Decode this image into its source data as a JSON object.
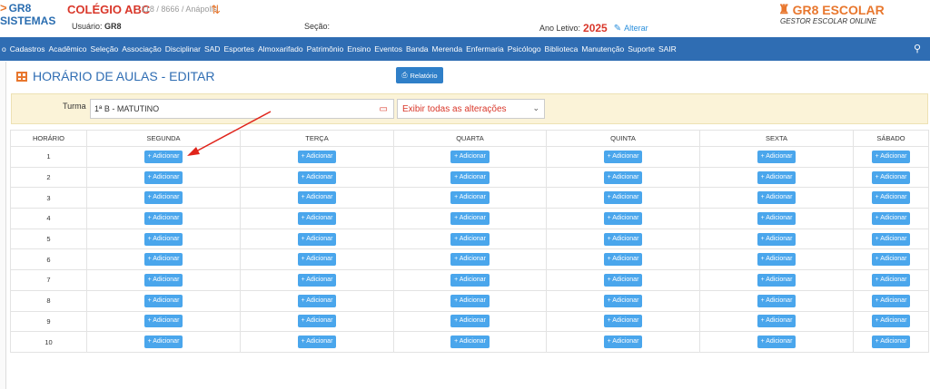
{
  "header": {
    "logo_line1": "GR8",
    "logo_line2": "SISTEMAS",
    "school_name": "COLÉGIO ABC",
    "school_info": "- 118 / 8666 / Anápolis",
    "usuario_label": "Usuário:",
    "usuario_value": "GR8",
    "secao_label": "Seção:",
    "ano_label": "Ano Letivo:",
    "ano_value": "2025",
    "alterar_label": "Alterar",
    "brand_title": "GR8 ESCOLAR",
    "brand_subtitle": "GESTOR ESCOLAR ONLINE"
  },
  "nav": {
    "items": [
      "o",
      "Cadastros",
      "Acadêmico",
      "Seleção",
      "Associação",
      "Disciplinar",
      "SAD",
      "Esportes",
      "Almoxarifado",
      "Patrimônio",
      "Ensino",
      "Eventos",
      "Banda",
      "Merenda",
      "Enfermaria",
      "Psicólogo",
      "Biblioteca",
      "Manutenção",
      "Suporte",
      "SAIR"
    ]
  },
  "page": {
    "title": "HORÁRIO DE AULAS - EDITAR",
    "relatorio_label": "Relatório"
  },
  "filter": {
    "turma_label": "Turma",
    "turma_value": "1ª B - MATUTINO",
    "exibir_value": "Exibir todas as alterações"
  },
  "table": {
    "headers": [
      "HORÁRIO",
      "SEGUNDA",
      "TERÇA",
      "QUARTA",
      "QUINTA",
      "SEXTA",
      "SÁBADO"
    ],
    "rows": [
      "1",
      "2",
      "3",
      "4",
      "5",
      "6",
      "7",
      "8",
      "9",
      "10"
    ],
    "add_label": "+ Adicionar"
  },
  "colors": {
    "nav_bg": "#2f6db3",
    "accent_orange": "#e8772e",
    "accent_red": "#d9372a",
    "button_blue": "#4aa6ec"
  }
}
